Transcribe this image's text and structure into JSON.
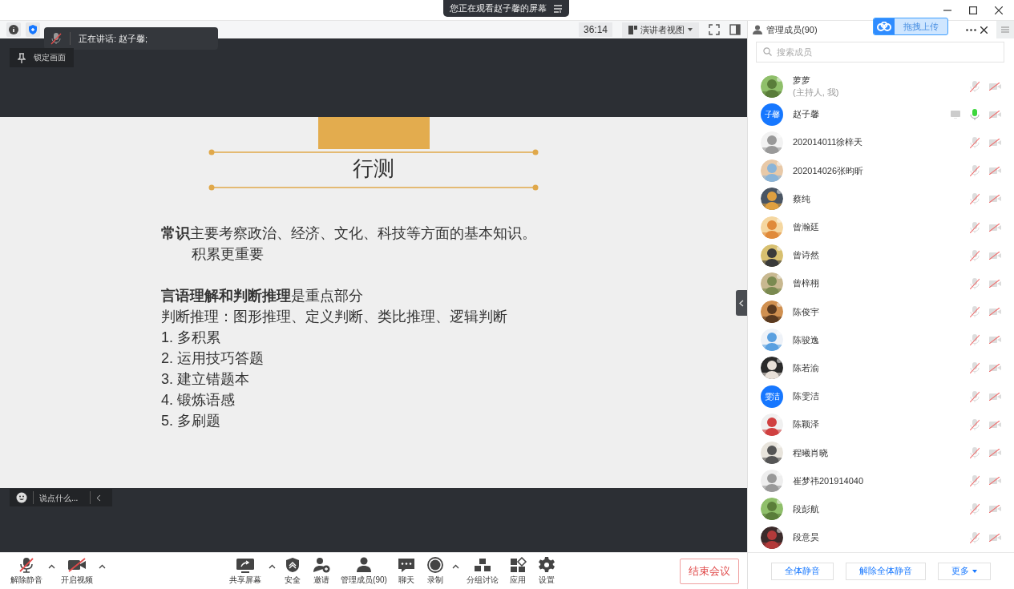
{
  "banner": {
    "text": "您正在观看赵子馨的屏幕"
  },
  "top_bar": {
    "timer": "36:14",
    "view_mode": "演讲者视图"
  },
  "speaking_toast": {
    "text": "正在讲话: 赵子馨;"
  },
  "lock_button": {
    "label": "锁定画面"
  },
  "slide": {
    "title": "行测",
    "lines": [
      {
        "text": "**常识**主要考察政治、经济、文化、科技等方面的基本知识。",
        "indent": false
      },
      {
        "text": "积累更重要",
        "indent": true
      },
      {
        "text": "**言语理解和判断推理**是重点部分",
        "indent": false,
        "gap": true
      },
      {
        "text": "判断推理：图形推理、定义判断、类比推理、逻辑判断",
        "indent": false
      },
      {
        "text": "1. 多积累",
        "indent": false
      },
      {
        "text": "2. 运用技巧答题",
        "indent": false
      },
      {
        "text": "3. 建立错题本",
        "indent": false
      },
      {
        "text": "4. 锻炼语感",
        "indent": false
      },
      {
        "text": "5. 多刷题",
        "indent": false
      }
    ]
  },
  "chat_input": {
    "placeholder": "说点什么..."
  },
  "toolbar": {
    "left": [
      {
        "kind": "mic-off",
        "label": "解除静音",
        "caret": true
      },
      {
        "kind": "video-off",
        "label": "开启视频",
        "caret": true
      }
    ],
    "center": [
      {
        "kind": "share",
        "label": "共享屏幕",
        "caret": true
      },
      {
        "kind": "shield",
        "label": "安全",
        "caret": false
      },
      {
        "kind": "invite",
        "label": "邀请",
        "caret": false
      },
      {
        "kind": "members",
        "label": "管理成员(90)",
        "caret": false
      },
      {
        "kind": "chat",
        "label": "聊天",
        "caret": false
      },
      {
        "kind": "record",
        "label": "录制",
        "caret": true
      },
      {
        "kind": "breakout",
        "label": "分组讨论",
        "caret": false
      },
      {
        "kind": "apps",
        "label": "应用",
        "caret": false
      },
      {
        "kind": "settings",
        "label": "设置",
        "caret": false
      }
    ],
    "end_button": "结束会议"
  },
  "panel": {
    "title": "管理成员(90)",
    "upload_button": "拖拽上传",
    "search": {
      "placeholder": "搜索成员"
    },
    "members": [
      {
        "name": "萝萝",
        "role": "(主持人, 我)",
        "muted": true,
        "camera_on": false,
        "sharing": false
      },
      {
        "name": "赵子馨",
        "avatar_text": "子馨",
        "muted": false,
        "camera_on": false,
        "sharing": true
      },
      {
        "name": "202014011徐梓天",
        "muted": true,
        "camera_on": false,
        "sharing": false
      },
      {
        "name": "202014026张昀昕",
        "muted": true,
        "camera_on": false,
        "sharing": false
      },
      {
        "name": "蔡纯",
        "muted": true,
        "camera_on": false,
        "sharing": false
      },
      {
        "name": "曾瀚廷",
        "muted": true,
        "camera_on": false,
        "sharing": false
      },
      {
        "name": "曾诗然",
        "muted": true,
        "camera_on": false,
        "sharing": false
      },
      {
        "name": "曾梓栩",
        "muted": true,
        "camera_on": false,
        "sharing": false
      },
      {
        "name": "陈俊宇",
        "muted": true,
        "camera_on": false,
        "sharing": false
      },
      {
        "name": "陈骏逸",
        "muted": true,
        "camera_on": false,
        "sharing": false
      },
      {
        "name": "陈若渝",
        "muted": true,
        "camera_on": false,
        "sharing": false
      },
      {
        "name": "陈雯洁",
        "avatar_text": "雯洁",
        "muted": true,
        "camera_on": false,
        "sharing": false
      },
      {
        "name": "陈颖泽",
        "muted": true,
        "camera_on": false,
        "sharing": false
      },
      {
        "name": "程曦肖晓",
        "muted": true,
        "camera_on": false,
        "sharing": false
      },
      {
        "name": "崔梦祎201914040",
        "muted": true,
        "camera_on": false,
        "sharing": false
      },
      {
        "name": "段彭航",
        "muted": true,
        "camera_on": false,
        "sharing": false
      },
      {
        "name": "段意昊",
        "muted": true,
        "camera_on": false,
        "sharing": false
      }
    ],
    "footer_buttons": [
      "全体静音",
      "解除全体静音"
    ],
    "more_button": "更多"
  }
}
